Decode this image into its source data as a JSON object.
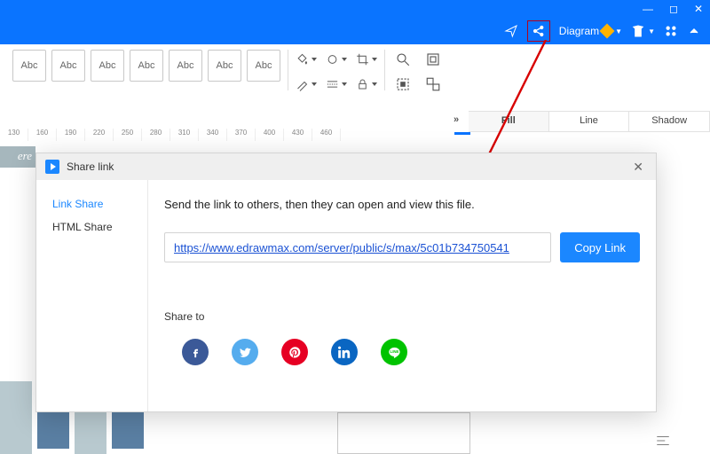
{
  "window": {
    "min": "—",
    "max": "◻",
    "close": "✕"
  },
  "header": {
    "diagram_label": "Diagram"
  },
  "toolbar": {
    "styles": [
      "Abc",
      "Abc",
      "Abc",
      "Abc",
      "Abc",
      "Abc",
      "Abc"
    ]
  },
  "proptabs": {
    "expand": "»",
    "tabs": [
      {
        "label": "Fill",
        "active": true
      },
      {
        "label": "Line",
        "active": false
      },
      {
        "label": "Shadow",
        "active": false
      }
    ]
  },
  "ruler": [
    "130",
    "160",
    "190",
    "220",
    "250",
    "280",
    "310",
    "340",
    "370",
    "400",
    "430",
    "460"
  ],
  "canvas": {
    "word_fragment": "ere"
  },
  "modal": {
    "title": "Share link",
    "close": "✕",
    "side": [
      {
        "label": "Link Share",
        "active": true
      },
      {
        "label": "HTML Share",
        "active": false
      }
    ],
    "instruction": "Send the link to others, then they can open and view this file.",
    "url": "https://www.edrawmax.com/server/public/s/max/5c01b734750541",
    "copy_label": "Copy Link",
    "share_to": "Share to",
    "socials": [
      {
        "name": "facebook"
      },
      {
        "name": "twitter"
      },
      {
        "name": "pinterest"
      },
      {
        "name": "linkedin"
      },
      {
        "name": "line"
      }
    ]
  }
}
